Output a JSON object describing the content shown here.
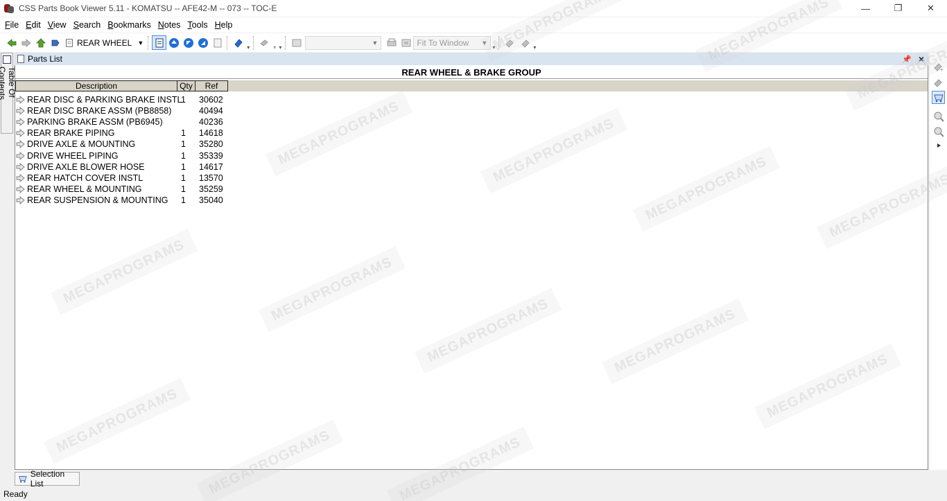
{
  "window": {
    "title": "CSS Parts Book Viewer 5.11 - KOMATSU -- AFE42-M -- 073 -- TOC-E",
    "minimize": "—",
    "restore": "❐",
    "close": "✕"
  },
  "menu": [
    {
      "u": "F",
      "rest": "ile"
    },
    {
      "u": "E",
      "rest": "dit"
    },
    {
      "u": "V",
      "rest": "iew"
    },
    {
      "u": "S",
      "rest": "earch"
    },
    {
      "u": "B",
      "rest": "ookmarks"
    },
    {
      "u": "N",
      "rest": "otes"
    },
    {
      "u": "T",
      "rest": "ools"
    },
    {
      "u": "H",
      "rest": "elp"
    }
  ],
  "toolbar": {
    "location": "REAR WHEEL",
    "zoom": "Fit To Window"
  },
  "sidetab": {
    "label": "Table Of Contents"
  },
  "panel": {
    "title": "Parts List",
    "pin": "📌",
    "close": "×"
  },
  "table": {
    "group_title": "REAR WHEEL & BRAKE GROUP",
    "headers": {
      "description": "Description",
      "qty": "Qty",
      "ref": "Ref"
    },
    "rows": [
      {
        "desc": "REAR DISC & PARKING BRAKE INSTL",
        "qty": "1",
        "ref": "30602"
      },
      {
        "desc": "REAR DISC BRAKE ASSM (PB8858)",
        "qty": "",
        "ref": "40494"
      },
      {
        "desc": "PARKING BRAKE ASSM (PB6945)",
        "qty": "",
        "ref": "40236"
      },
      {
        "desc": "REAR BRAKE PIPING",
        "qty": "1",
        "ref": "14618"
      },
      {
        "desc": "DRIVE AXLE & MOUNTING",
        "qty": "1",
        "ref": "35280"
      },
      {
        "desc": "DRIVE WHEEL PIPING",
        "qty": "1",
        "ref": "35339"
      },
      {
        "desc": "DRIVE AXLE BLOWER HOSE",
        "qty": "1",
        "ref": "14617"
      },
      {
        "desc": "REAR HATCH COVER INSTL",
        "qty": "1",
        "ref": "13570"
      },
      {
        "desc": "REAR WHEEL & MOUNTING",
        "qty": "1",
        "ref": "35259"
      },
      {
        "desc": "REAR SUSPENSION & MOUNTING",
        "qty": "1",
        "ref": "35040"
      }
    ]
  },
  "bottom_tab": {
    "label": "Selection List"
  },
  "status": {
    "text": "Ready"
  },
  "watermark": "MEGAPROGRAMS"
}
